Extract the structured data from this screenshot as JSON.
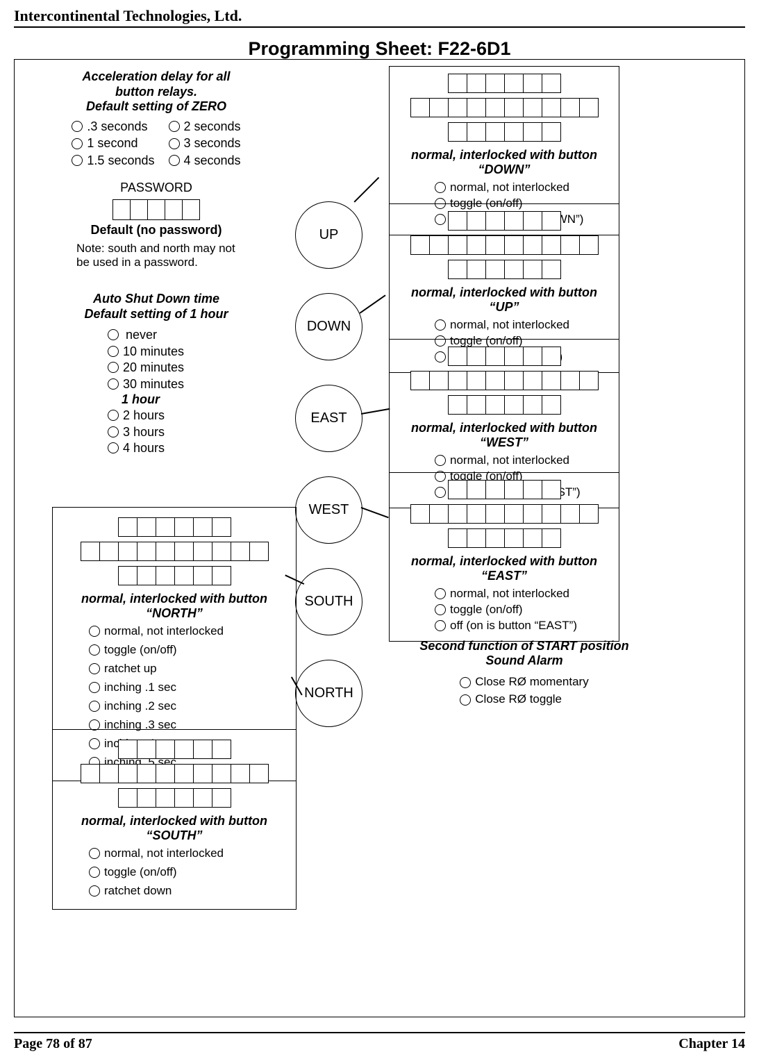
{
  "company": "Intercontinental Technologies, Ltd.",
  "title": "Programming Sheet:  F22-6D1",
  "footer_left": "Page 78 of 87",
  "footer_right": "Chapter 14",
  "accel": {
    "title_l1": "Acceleration delay for all",
    "title_l2": "button relays.",
    "title_l3": "Default setting of ZERO",
    "col1": [
      ".3 seconds",
      "1 second",
      "1.5 seconds"
    ],
    "col2": [
      "2 seconds",
      "3 seconds",
      "4 seconds"
    ]
  },
  "password": {
    "label": "PASSWORD",
    "default": "Default (no password)",
    "note": "Note: south and north may not be used in a password."
  },
  "autoshut": {
    "title_l1": "Auto Shut Down time",
    "title_l2": "Default setting of 1 hour",
    "opts": [
      "never",
      "10 minutes",
      "20 minutes",
      "30 minutes"
    ],
    "selected": "1 hour",
    "opts2": [
      "2 hours",
      "3 hours",
      "4 hours"
    ]
  },
  "dir": {
    "up": "UP",
    "down": "DOWN",
    "east": "EAST",
    "west": "WEST",
    "south": "SOUTH",
    "north": "NORTH"
  },
  "box_up": {
    "title": "normal, interlocked with button “DOWN”",
    "opts": [
      "normal, not interlocked",
      "toggle (on/off)",
      "on (off is button “DOWN”)"
    ]
  },
  "box_down": {
    "title": "normal, interlocked with button “UP”",
    "opts": [
      "normal, not interlocked",
      "toggle (on/off)",
      "off (on is button “UP”)"
    ]
  },
  "box_east": {
    "title": "normal, interlocked with button “WEST”",
    "opts": [
      "normal, not interlocked",
      "toggle (on/off)",
      "on (off is button “WEST”)"
    ]
  },
  "box_west": {
    "title": "normal, interlocked with button “EAST”",
    "opts": [
      "normal, not interlocked",
      "toggle (on/off)",
      "off (on is button “EAST”)"
    ]
  },
  "box_south": {
    "title": "normal, interlocked with button “NORTH”",
    "opts": [
      "normal, not interlocked",
      "toggle (on/off)",
      "ratchet up",
      "inching .1 sec",
      "inching .2 sec",
      "inching .3 sec",
      "inching .4 sec",
      "inching .5 sec"
    ]
  },
  "box_north": {
    "title": "normal, interlocked with button “SOUTH”",
    "opts": [
      "normal, not interlocked",
      "toggle (on/off)",
      "ratchet down"
    ]
  },
  "second_fn": {
    "title_l1": "Second function of START position",
    "title_l2": "Sound Alarm",
    "opts": [
      "Close RØ momentary",
      "Close RØ toggle"
    ]
  }
}
